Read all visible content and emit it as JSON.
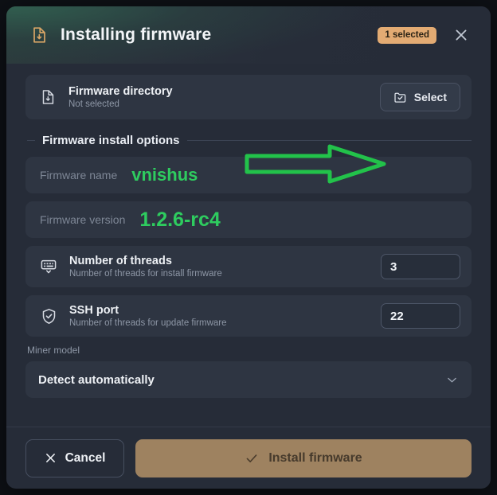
{
  "header": {
    "icon": "file-download-icon",
    "title": "Installing firmware",
    "badge": "1 selected",
    "close_icon": "close-icon"
  },
  "firmware_directory": {
    "icon": "file-download-icon",
    "title": "Firmware directory",
    "status": "Not selected",
    "select_button": {
      "label": "Select",
      "icon": "folder-check-icon"
    }
  },
  "section": {
    "title": "Firmware install options"
  },
  "firmware_name": {
    "label": "Firmware name",
    "value": "vnishus"
  },
  "firmware_version": {
    "label": "Firmware version",
    "value": "1.2.6-rc4"
  },
  "threads": {
    "icon": "keypad-icon",
    "title": "Number of threads",
    "subtitle": "Number of threads for install firmware",
    "value": "3"
  },
  "ssh_port": {
    "icon": "shield-check-icon",
    "title": "SSH port",
    "subtitle": "Number of threads for update firmware",
    "value": "22"
  },
  "miner_model": {
    "label": "Miner model",
    "selected": "Detect automatically",
    "chevron_icon": "chevron-down-icon"
  },
  "footer": {
    "cancel": {
      "label": "Cancel",
      "icon": "close-icon"
    },
    "install": {
      "label": "Install firmware",
      "icon": "check-icon"
    }
  },
  "annotation": {
    "type": "arrow-right",
    "color": "#22c24a",
    "target": "select-button"
  },
  "colors": {
    "accent_green": "#2ecc5f",
    "badge_bg": "#e3ab73",
    "install_bg": "#9e8260",
    "dialog_bg": "#262c38",
    "card_bg": "#2e3542"
  }
}
